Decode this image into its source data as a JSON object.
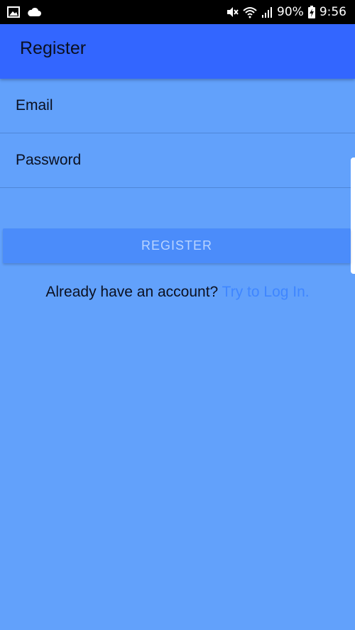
{
  "status_bar": {
    "battery_text": "90%",
    "time": "9:56",
    "icons": [
      "image-icon",
      "cloud-icon",
      "mute-icon",
      "wifi-icon",
      "signal-icon",
      "battery-icon"
    ]
  },
  "app_bar": {
    "title": "Register"
  },
  "form": {
    "email_placeholder": "Email",
    "email_value": "",
    "password_placeholder": "Password",
    "password_value": "",
    "register_label": "REGISTER"
  },
  "footer": {
    "prompt": "Already have an account? ",
    "link_label": "Try to Log In."
  },
  "colors": {
    "background": "#62a1fb",
    "app_bar": "#3366ff",
    "button": "#4b8cfa",
    "button_text": "#b9d4ff",
    "link": "#3f86ff"
  }
}
